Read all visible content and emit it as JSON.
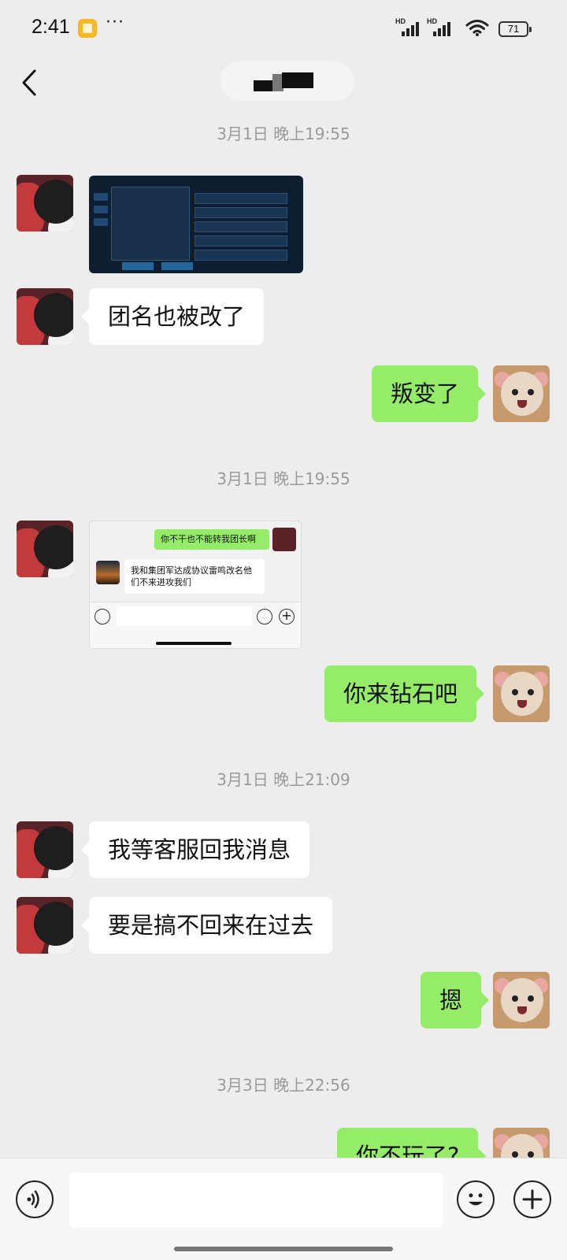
{
  "status_bar": {
    "time": "2:41",
    "more": "···",
    "signal_1": "HD",
    "signal_2": "HD",
    "battery": "71"
  },
  "header": {
    "back_icon": "chevron-left-icon",
    "title": ""
  },
  "messages": [
    {
      "type": "timestamp",
      "text": "3月1日 晚上19:55"
    },
    {
      "type": "image",
      "side": "left",
      "description_icon": "game-screenshot"
    },
    {
      "type": "text",
      "side": "left",
      "text": "团名也被改了"
    },
    {
      "type": "text",
      "side": "right",
      "text": "叛变了"
    },
    {
      "type": "timestamp",
      "text": "3月1日 晚上19:55"
    },
    {
      "type": "image",
      "side": "left",
      "description_icon": "chat-screenshot"
    },
    {
      "type": "text",
      "side": "right",
      "text": "你来钻石吧"
    },
    {
      "type": "timestamp",
      "text": "3月1日 晚上21:09"
    },
    {
      "type": "text",
      "side": "left",
      "text": "我等客服回我消息"
    },
    {
      "type": "text",
      "side": "left",
      "text": "要是搞不回来在过去"
    },
    {
      "type": "text",
      "side": "right",
      "text": "摁"
    },
    {
      "type": "timestamp",
      "text": "3月3日 晚上22:56"
    },
    {
      "type": "text",
      "side": "right",
      "text": "你不玩了?"
    }
  ],
  "screenshot_chat": {
    "sent": "你不干也不能转我团长啊",
    "received": "我和集团军达成协议雷鸣改名他们不来进攻我们"
  },
  "input_bar": {
    "voice_icon": "voice-icon",
    "emoji_icon": "emoji-icon",
    "plus_icon": "plus-icon",
    "placeholder": ""
  },
  "colors": {
    "background": "#ededed",
    "bubble_sent": "#95ec69",
    "bubble_received": "#ffffff",
    "timestamp": "#9a9a9a"
  }
}
